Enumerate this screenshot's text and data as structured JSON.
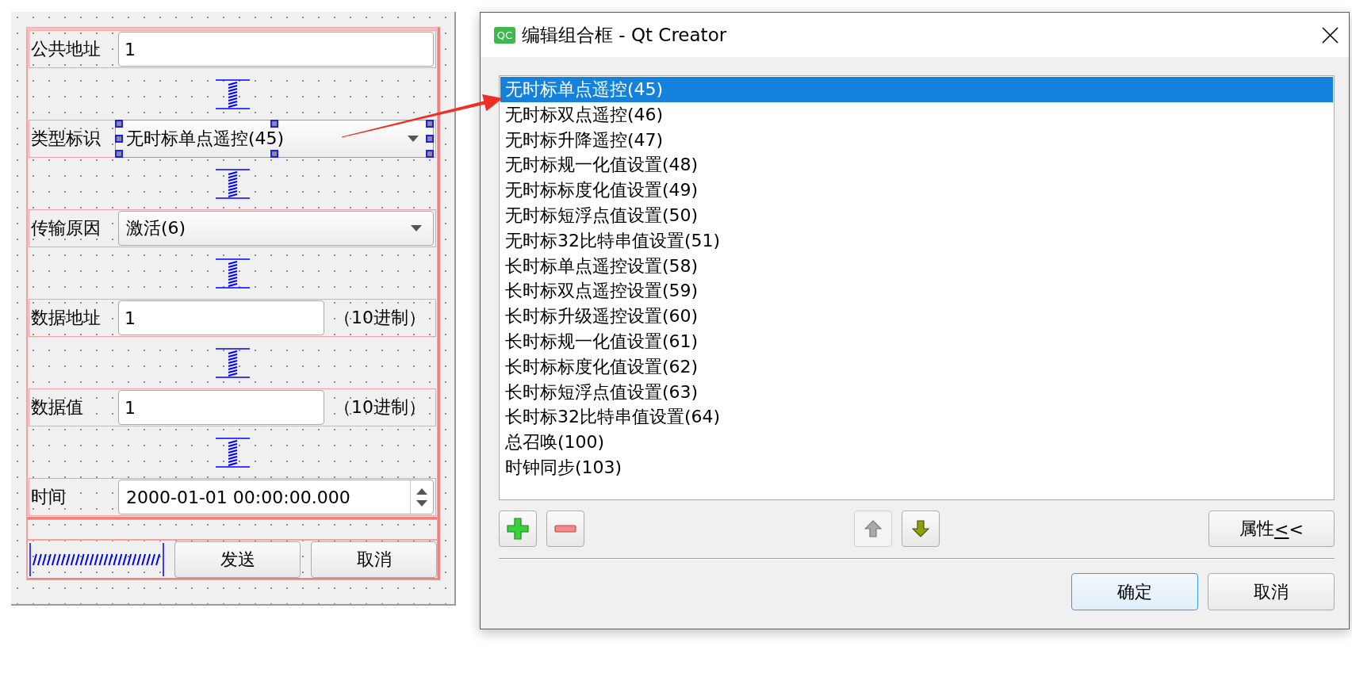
{
  "designer_form": {
    "rows": [
      {
        "kind": "line_edit",
        "label": "公共地址",
        "value": "1",
        "selected": false
      },
      {
        "kind": "combo",
        "label": "类型标识",
        "value": "无时标单点遥控(45)",
        "selected": true
      },
      {
        "kind": "combo",
        "label": "传输原因",
        "value": "激活(6)",
        "selected": false
      },
      {
        "kind": "line_edit",
        "label": "数据地址",
        "value": "1",
        "suffix": "（10进制）",
        "selected": false
      },
      {
        "kind": "line_edit",
        "label": "数据值",
        "value": "1",
        "suffix": "（10进制）",
        "selected": false
      },
      {
        "kind": "datetime",
        "label": "时间",
        "value": "2000-01-01 00:00:00.000",
        "selected": false
      }
    ],
    "buttons": [
      "发送",
      "取消"
    ]
  },
  "dialog": {
    "icon_text": "QC",
    "title": "编辑组合框 - Qt Creator",
    "items": [
      {
        "label": "无时标单点遥控(45)",
        "selected": true
      },
      {
        "label": "无时标双点遥控(46)",
        "selected": false
      },
      {
        "label": "无时标升降遥控(47)",
        "selected": false
      },
      {
        "label": "无时标规一化值设置(48)",
        "selected": false
      },
      {
        "label": "无时标标度化值设置(49)",
        "selected": false
      },
      {
        "label": "无时标短浮点值设置(50)",
        "selected": false
      },
      {
        "label": "无时标32比特串值设置(51)",
        "selected": false
      },
      {
        "label": "长时标单点遥控设置(58)",
        "selected": false
      },
      {
        "label": "长时标双点遥控设置(59)",
        "selected": false
      },
      {
        "label": "长时标升级遥控设置(60)",
        "selected": false
      },
      {
        "label": "长时标规一化值设置(61)",
        "selected": false
      },
      {
        "label": "长时标标度化值设置(62)",
        "selected": false
      },
      {
        "label": "长时标短浮点值设置(63)",
        "selected": false
      },
      {
        "label": "长时标32比特串值设置(64)",
        "selected": false
      },
      {
        "label": "总召唤(100)",
        "selected": false
      },
      {
        "label": "时钟同步(103)",
        "selected": false
      }
    ],
    "toolbar": [
      {
        "kind": "add",
        "disabled": false
      },
      {
        "kind": "remove",
        "disabled": false
      },
      {
        "kind": "move_up",
        "disabled": true
      },
      {
        "kind": "move_down",
        "disabled": false
      }
    ],
    "properties_button": {
      "label_segments": [
        {
          "text": "属性",
          "underlined": false
        },
        {
          "text": "<",
          "underlined": true
        },
        {
          "text": "<",
          "underlined": false
        }
      ]
    },
    "buttons": [
      {
        "label": "确定",
        "default": true
      },
      {
        "label": "取消",
        "default": false
      }
    ]
  }
}
